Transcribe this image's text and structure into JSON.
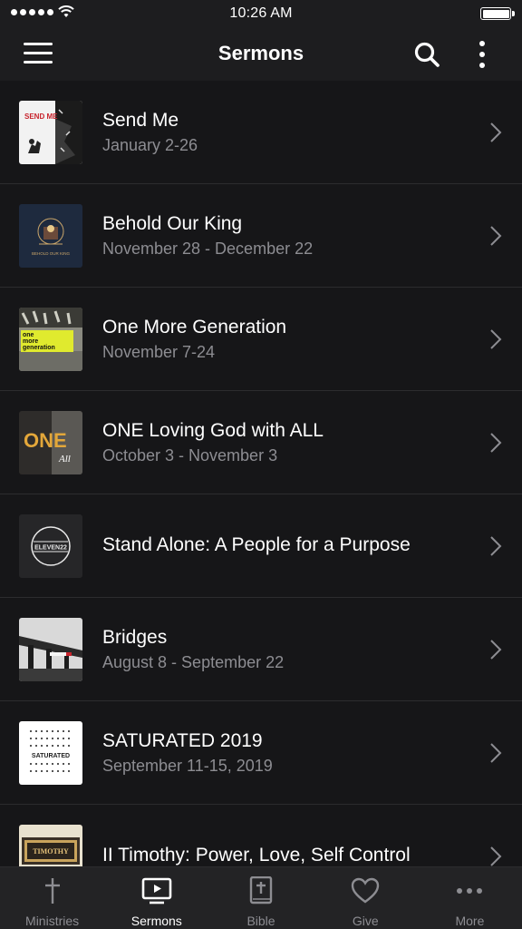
{
  "status_bar": {
    "time": "10:26 AM"
  },
  "header": {
    "title": "Sermons"
  },
  "sermons": [
    {
      "title": "Send Me",
      "dates": "January 2-26",
      "thumb_text": "SEND ME"
    },
    {
      "title": "Behold Our King",
      "dates": "November 28 - December 22",
      "thumb_text": "BEHOLD OUR KING"
    },
    {
      "title": "One More Generation",
      "dates": "November 7-24",
      "thumb_text_lines": [
        "one",
        "more",
        "generation"
      ]
    },
    {
      "title": "ONE Loving God with ALL",
      "dates": "October 3 - November 3",
      "thumb_text": "ONE",
      "thumb_text_2": "All"
    },
    {
      "title": "Stand Alone: A People for a Purpose",
      "dates": "",
      "thumb_text": "ELEVEN22"
    },
    {
      "title": "Bridges",
      "dates": "August 8 - September 22"
    },
    {
      "title": "SATURATED 2019",
      "dates": "September 11-15, 2019",
      "thumb_text": "SATURATED"
    },
    {
      "title": "II Timothy: Power, Love, Self Control",
      "dates": "",
      "thumb_text": "TIMOTHY"
    }
  ],
  "tabs": [
    {
      "label": "Ministries",
      "icon": "cross-icon",
      "active": false
    },
    {
      "label": "Sermons",
      "icon": "tv-play-icon",
      "active": true
    },
    {
      "label": "Bible",
      "icon": "bible-icon",
      "active": false
    },
    {
      "label": "Give",
      "icon": "heart-icon",
      "active": false
    },
    {
      "label": "More",
      "icon": "ellipsis-icon",
      "active": false
    }
  ]
}
